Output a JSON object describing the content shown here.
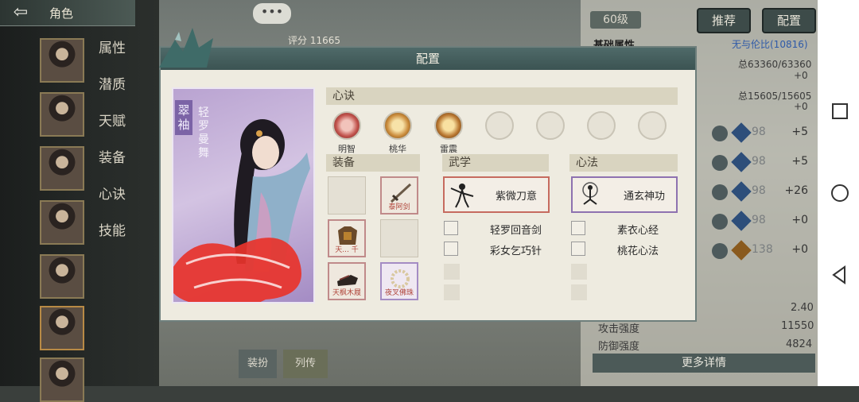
{
  "topbar": {
    "back_icon": "back-arrow-icon",
    "title": "角色"
  },
  "chat": {
    "icon": "chat-bubble-icon",
    "text": "•••"
  },
  "side_menu": {
    "items": [
      "属性",
      "潜质",
      "天赋",
      "装备",
      "心诀",
      "技能"
    ]
  },
  "top_right": {
    "level": "60级",
    "recommend": "推荐",
    "config": "配置"
  },
  "behind": {
    "score": "评分 11665",
    "base_attr_label": "基础属性",
    "peerless": "无与伦比(10816)",
    "total1": "总63360/63360",
    "plus1": "+0",
    "total2": "总15605/15605",
    "plus2": "+0",
    "attrs": [
      {
        "val": "98",
        "bonus": "+5"
      },
      {
        "val": "98",
        "bonus": "+5"
      },
      {
        "val": "98",
        "bonus": "+26"
      },
      {
        "val": "98",
        "bonus": "+0"
      },
      {
        "val": "138",
        "bonus": "+0"
      }
    ],
    "stat_value_top": "2.40",
    "attack_label": "攻击强度",
    "attack_value": "11550",
    "defense_label": "防御强度",
    "defense_value": "4824",
    "more_detail": "更多详情",
    "bottom_btn1": "装扮",
    "bottom_btn2": "列传"
  },
  "modal": {
    "title": "配置",
    "card": {
      "tag": "翠袖",
      "name": "轻罗曼舞"
    },
    "xinjue": {
      "title": "心诀",
      "skills": [
        {
          "name": "明智",
          "color": "#c0504a"
        },
        {
          "name": "桃华",
          "color": "#c98a3a"
        },
        {
          "name": "雷震",
          "color": "#b7752f"
        },
        {
          "name": "",
          "color": ""
        },
        {
          "name": "",
          "color": ""
        },
        {
          "name": "",
          "color": ""
        },
        {
          "name": "",
          "color": ""
        }
      ]
    },
    "equip": {
      "title": "装备",
      "slots": [
        "",
        "泰阿剑",
        "天... 千",
        "",
        "天枫木屐",
        "夜叉佛珠"
      ]
    },
    "wuxue": {
      "title": "武学",
      "main": "紫微刀意",
      "subs": [
        "轻罗回音剑",
        "彩女乞巧针"
      ]
    },
    "xinfa": {
      "title": "心法",
      "main": "通玄神功",
      "subs": [
        "素衣心经",
        "桃花心法"
      ]
    }
  },
  "android": {
    "recent": "recent-apps-icon",
    "home": "home-icon",
    "back": "back-triangle-icon"
  }
}
